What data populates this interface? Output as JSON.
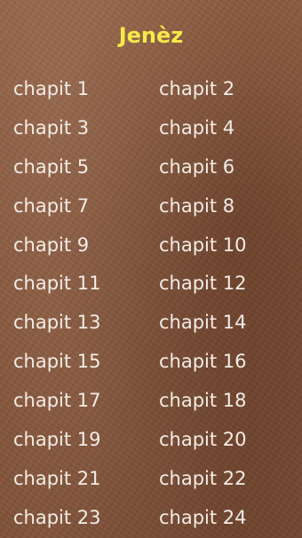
{
  "header": {
    "title": "Jenèz"
  },
  "colors": {
    "title": "#f6e94a",
    "chapter_text": "#f3ece6",
    "background": "#8a5a3f"
  },
  "chapters": [
    "chapit 1",
    "chapit 2",
    "chapit 3",
    "chapit 4",
    "chapit 5",
    "chapit 6",
    "chapit 7",
    "chapit 8",
    "chapit 9",
    "chapit 10",
    "chapit 11",
    "chapit 12",
    "chapit 13",
    "chapit 14",
    "chapit 15",
    "chapit 16",
    "chapit 17",
    "chapit 18",
    "chapit 19",
    "chapit 20",
    "chapit 21",
    "chapit 22",
    "chapit 23",
    "chapit 24"
  ]
}
